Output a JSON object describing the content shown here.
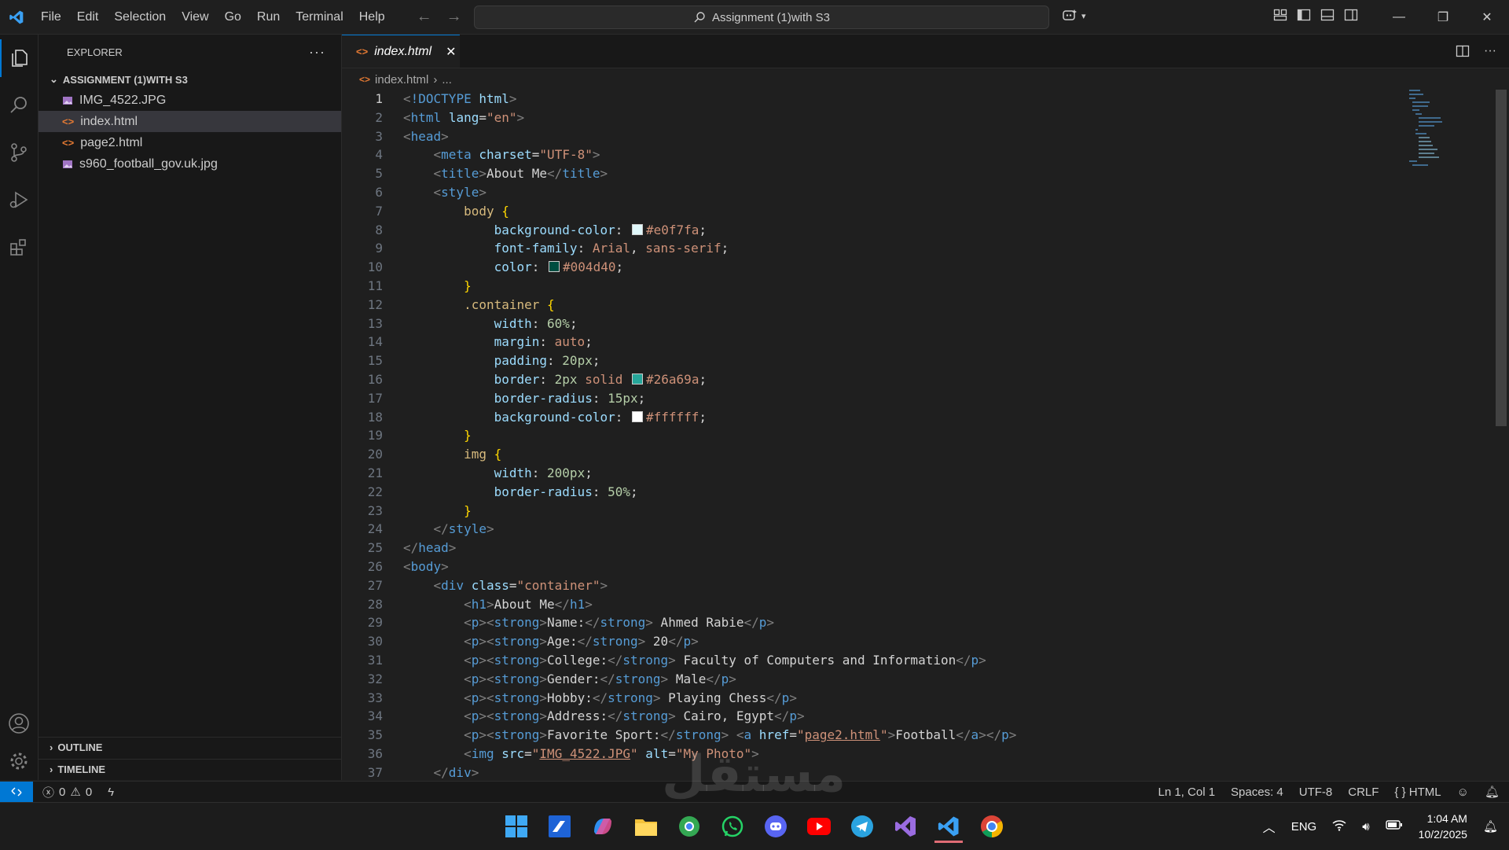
{
  "menu": [
    "File",
    "Edit",
    "Selection",
    "View",
    "Go",
    "Run",
    "Terminal",
    "Help"
  ],
  "search": {
    "text": "Assignment (1)with S3"
  },
  "explorer": {
    "title": "EXPLORER",
    "folder": "ASSIGNMENT (1)WITH S3",
    "files": [
      {
        "name": "IMG_4522.JPG",
        "type": "image"
      },
      {
        "name": "index.html",
        "type": "html",
        "selected": true
      },
      {
        "name": "page2.html",
        "type": "html"
      },
      {
        "name": "s960_football_gov.uk.jpg",
        "type": "image"
      }
    ],
    "outline": "OUTLINE",
    "timeline": "TIMELINE"
  },
  "tab": {
    "label": "index.html"
  },
  "breadcrumb": {
    "file": "index.html",
    "more": "..."
  },
  "code": {
    "current_line": 1,
    "lines": [
      [
        [
          "br",
          "<"
        ],
        [
          "tag",
          "!DOCTYPE "
        ],
        [
          "attr",
          "html"
        ],
        [
          "br",
          ">"
        ]
      ],
      [
        [
          "br",
          "<"
        ],
        [
          "tag",
          "html "
        ],
        [
          "attr",
          "lang"
        ],
        [
          "text",
          "="
        ],
        [
          "str",
          "\"en\""
        ],
        [
          "br",
          ">"
        ]
      ],
      [
        [
          "br",
          "<"
        ],
        [
          "tag",
          "head"
        ],
        [
          "br",
          ">"
        ]
      ],
      [
        [
          "text",
          "    "
        ],
        [
          "br",
          "<"
        ],
        [
          "tag",
          "meta "
        ],
        [
          "attr",
          "charset"
        ],
        [
          "text",
          "="
        ],
        [
          "str",
          "\"UTF-8\""
        ],
        [
          "br",
          ">"
        ]
      ],
      [
        [
          "text",
          "    "
        ],
        [
          "br",
          "<"
        ],
        [
          "tag",
          "title"
        ],
        [
          "br",
          ">"
        ],
        [
          "text",
          "About Me"
        ],
        [
          "br",
          "</"
        ],
        [
          "tag",
          "title"
        ],
        [
          "br",
          ">"
        ]
      ],
      [
        [
          "text",
          "    "
        ],
        [
          "br",
          "<"
        ],
        [
          "tag",
          "style"
        ],
        [
          "br",
          ">"
        ]
      ],
      [
        [
          "text",
          "        "
        ],
        [
          "sel",
          "body "
        ],
        [
          "brace",
          "{"
        ]
      ],
      [
        [
          "text",
          "            "
        ],
        [
          "prop",
          "background-color"
        ],
        [
          "text",
          ": "
        ],
        [
          "swatch",
          "#e0f7fa"
        ],
        [
          "val",
          "#e0f7fa"
        ],
        [
          "text",
          ";"
        ]
      ],
      [
        [
          "text",
          "            "
        ],
        [
          "prop",
          "font-family"
        ],
        [
          "text",
          ": "
        ],
        [
          "val",
          "Arial"
        ],
        [
          "text",
          ", "
        ],
        [
          "val",
          "sans-serif"
        ],
        [
          "text",
          ";"
        ]
      ],
      [
        [
          "text",
          "            "
        ],
        [
          "prop",
          "color"
        ],
        [
          "text",
          ": "
        ],
        [
          "swatch",
          "#004d40"
        ],
        [
          "val",
          "#004d40"
        ],
        [
          "text",
          ";"
        ]
      ],
      [
        [
          "text",
          "        "
        ],
        [
          "brace",
          "}"
        ]
      ],
      [
        [
          "text",
          "        "
        ],
        [
          "sel",
          ".container "
        ],
        [
          "brace",
          "{"
        ]
      ],
      [
        [
          "text",
          "            "
        ],
        [
          "prop",
          "width"
        ],
        [
          "text",
          ": "
        ],
        [
          "num",
          "60%"
        ],
        [
          "text",
          ";"
        ]
      ],
      [
        [
          "text",
          "            "
        ],
        [
          "prop",
          "margin"
        ],
        [
          "text",
          ": "
        ],
        [
          "val",
          "auto"
        ],
        [
          "text",
          ";"
        ]
      ],
      [
        [
          "text",
          "            "
        ],
        [
          "prop",
          "padding"
        ],
        [
          "text",
          ": "
        ],
        [
          "num",
          "20px"
        ],
        [
          "text",
          ";"
        ]
      ],
      [
        [
          "text",
          "            "
        ],
        [
          "prop",
          "border"
        ],
        [
          "text",
          ": "
        ],
        [
          "num",
          "2px"
        ],
        [
          "text",
          " "
        ],
        [
          "val",
          "solid"
        ],
        [
          "text",
          " "
        ],
        [
          "swatch",
          "#26a69a"
        ],
        [
          "val",
          "#26a69a"
        ],
        [
          "text",
          ";"
        ]
      ],
      [
        [
          "text",
          "            "
        ],
        [
          "prop",
          "border-radius"
        ],
        [
          "text",
          ": "
        ],
        [
          "num",
          "15px"
        ],
        [
          "text",
          ";"
        ]
      ],
      [
        [
          "text",
          "            "
        ],
        [
          "prop",
          "background-color"
        ],
        [
          "text",
          ": "
        ],
        [
          "swatch",
          "#ffffff"
        ],
        [
          "val",
          "#ffffff"
        ],
        [
          "text",
          ";"
        ]
      ],
      [
        [
          "text",
          "        "
        ],
        [
          "brace",
          "}"
        ]
      ],
      [
        [
          "text",
          "        "
        ],
        [
          "sel",
          "img "
        ],
        [
          "brace",
          "{"
        ]
      ],
      [
        [
          "text",
          "            "
        ],
        [
          "prop",
          "width"
        ],
        [
          "text",
          ": "
        ],
        [
          "num",
          "200px"
        ],
        [
          "text",
          ";"
        ]
      ],
      [
        [
          "text",
          "            "
        ],
        [
          "prop",
          "border-radius"
        ],
        [
          "text",
          ": "
        ],
        [
          "num",
          "50%"
        ],
        [
          "text",
          ";"
        ]
      ],
      [
        [
          "text",
          "        "
        ],
        [
          "brace",
          "}"
        ]
      ],
      [
        [
          "text",
          "    "
        ],
        [
          "br",
          "</"
        ],
        [
          "tag",
          "style"
        ],
        [
          "br",
          ">"
        ]
      ],
      [
        [
          "br",
          "</"
        ],
        [
          "tag",
          "head"
        ],
        [
          "br",
          ">"
        ]
      ],
      [
        [
          "br",
          "<"
        ],
        [
          "tag",
          "body"
        ],
        [
          "br",
          ">"
        ]
      ],
      [
        [
          "text",
          "    "
        ],
        [
          "br",
          "<"
        ],
        [
          "tag",
          "div "
        ],
        [
          "attr",
          "class"
        ],
        [
          "text",
          "="
        ],
        [
          "str",
          "\"container\""
        ],
        [
          "br",
          ">"
        ]
      ],
      [
        [
          "text",
          "        "
        ],
        [
          "br",
          "<"
        ],
        [
          "tag",
          "h1"
        ],
        [
          "br",
          ">"
        ],
        [
          "text",
          "About Me"
        ],
        [
          "br",
          "</"
        ],
        [
          "tag",
          "h1"
        ],
        [
          "br",
          ">"
        ]
      ],
      [
        [
          "text",
          "        "
        ],
        [
          "br",
          "<"
        ],
        [
          "tag",
          "p"
        ],
        [
          "br",
          "><"
        ],
        [
          "tag",
          "strong"
        ],
        [
          "br",
          ">"
        ],
        [
          "text",
          "Name:"
        ],
        [
          "br",
          "</"
        ],
        [
          "tag",
          "strong"
        ],
        [
          "br",
          ">"
        ],
        [
          "text",
          " Ahmed Rabie"
        ],
        [
          "br",
          "</"
        ],
        [
          "tag",
          "p"
        ],
        [
          "br",
          ">"
        ]
      ],
      [
        [
          "text",
          "        "
        ],
        [
          "br",
          "<"
        ],
        [
          "tag",
          "p"
        ],
        [
          "br",
          "><"
        ],
        [
          "tag",
          "strong"
        ],
        [
          "br",
          ">"
        ],
        [
          "text",
          "Age:"
        ],
        [
          "br",
          "</"
        ],
        [
          "tag",
          "strong"
        ],
        [
          "br",
          ">"
        ],
        [
          "text",
          " 20"
        ],
        [
          "br",
          "</"
        ],
        [
          "tag",
          "p"
        ],
        [
          "br",
          ">"
        ]
      ],
      [
        [
          "text",
          "        "
        ],
        [
          "br",
          "<"
        ],
        [
          "tag",
          "p"
        ],
        [
          "br",
          "><"
        ],
        [
          "tag",
          "strong"
        ],
        [
          "br",
          ">"
        ],
        [
          "text",
          "College:"
        ],
        [
          "br",
          "</"
        ],
        [
          "tag",
          "strong"
        ],
        [
          "br",
          ">"
        ],
        [
          "text",
          " Faculty of Computers and Information"
        ],
        [
          "br",
          "</"
        ],
        [
          "tag",
          "p"
        ],
        [
          "br",
          ">"
        ]
      ],
      [
        [
          "text",
          "        "
        ],
        [
          "br",
          "<"
        ],
        [
          "tag",
          "p"
        ],
        [
          "br",
          "><"
        ],
        [
          "tag",
          "strong"
        ],
        [
          "br",
          ">"
        ],
        [
          "text",
          "Gender:"
        ],
        [
          "br",
          "</"
        ],
        [
          "tag",
          "strong"
        ],
        [
          "br",
          ">"
        ],
        [
          "text",
          " Male"
        ],
        [
          "br",
          "</"
        ],
        [
          "tag",
          "p"
        ],
        [
          "br",
          ">"
        ]
      ],
      [
        [
          "text",
          "        "
        ],
        [
          "br",
          "<"
        ],
        [
          "tag",
          "p"
        ],
        [
          "br",
          "><"
        ],
        [
          "tag",
          "strong"
        ],
        [
          "br",
          ">"
        ],
        [
          "text",
          "Hobby:"
        ],
        [
          "br",
          "</"
        ],
        [
          "tag",
          "strong"
        ],
        [
          "br",
          ">"
        ],
        [
          "text",
          " Playing Chess"
        ],
        [
          "br",
          "</"
        ],
        [
          "tag",
          "p"
        ],
        [
          "br",
          ">"
        ]
      ],
      [
        [
          "text",
          "        "
        ],
        [
          "br",
          "<"
        ],
        [
          "tag",
          "p"
        ],
        [
          "br",
          "><"
        ],
        [
          "tag",
          "strong"
        ],
        [
          "br",
          ">"
        ],
        [
          "text",
          "Address:"
        ],
        [
          "br",
          "</"
        ],
        [
          "tag",
          "strong"
        ],
        [
          "br",
          ">"
        ],
        [
          "text",
          " Cairo, Egypt"
        ],
        [
          "br",
          "</"
        ],
        [
          "tag",
          "p"
        ],
        [
          "br",
          ">"
        ]
      ],
      [
        [
          "text",
          "        "
        ],
        [
          "br",
          "<"
        ],
        [
          "tag",
          "p"
        ],
        [
          "br",
          "><"
        ],
        [
          "tag",
          "strong"
        ],
        [
          "br",
          ">"
        ],
        [
          "text",
          "Favorite Sport:"
        ],
        [
          "br",
          "</"
        ],
        [
          "tag",
          "strong"
        ],
        [
          "br",
          ">"
        ],
        [
          "text",
          " "
        ],
        [
          "br",
          "<"
        ],
        [
          "tag",
          "a "
        ],
        [
          "attr",
          "href"
        ],
        [
          "text",
          "="
        ],
        [
          "str",
          "\""
        ],
        [
          "link",
          "page2.html"
        ],
        [
          "str",
          "\""
        ],
        [
          "br",
          ">"
        ],
        [
          "text",
          "Football"
        ],
        [
          "br",
          "</"
        ],
        [
          "tag",
          "a"
        ],
        [
          "br",
          "></"
        ],
        [
          "tag",
          "p"
        ],
        [
          "br",
          ">"
        ]
      ],
      [
        [
          "text",
          "        "
        ],
        [
          "br",
          "<"
        ],
        [
          "tag",
          "img "
        ],
        [
          "attr",
          "src"
        ],
        [
          "text",
          "="
        ],
        [
          "str",
          "\""
        ],
        [
          "link",
          "IMG_4522.JPG"
        ],
        [
          "str",
          "\""
        ],
        [
          "text",
          " "
        ],
        [
          "attr",
          "alt"
        ],
        [
          "text",
          "="
        ],
        [
          "str",
          "\"My Photo\""
        ],
        [
          "br",
          ">"
        ]
      ],
      [
        [
          "text",
          "    "
        ],
        [
          "br",
          "</"
        ],
        [
          "tag",
          "div"
        ],
        [
          "br",
          ">"
        ]
      ]
    ]
  },
  "status": {
    "errors": "0",
    "warnings": "0",
    "position": "Ln 1, Col 1",
    "spaces": "Spaces: 4",
    "encoding": "UTF-8",
    "eol": "CRLF",
    "language": "HTML"
  },
  "taskbar": {
    "language": "ENG",
    "time": "1:04 AM",
    "date": "10/2/2025"
  },
  "watermark": "مستقل",
  "colors": {
    "accent": "#0078d4",
    "editor_bg": "#1f1f1f",
    "sidebar_bg": "#181818"
  }
}
